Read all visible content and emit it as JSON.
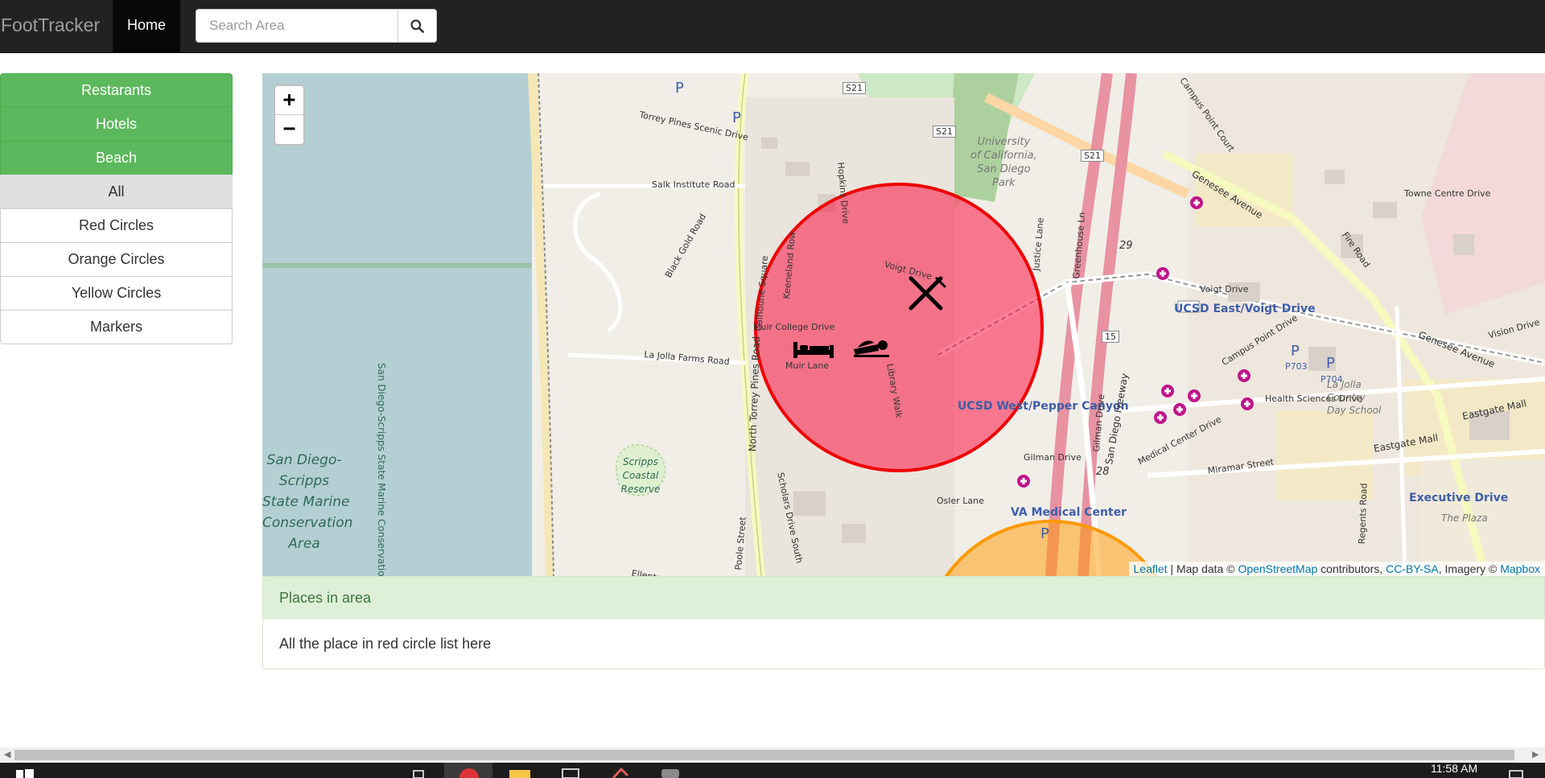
{
  "navbar": {
    "brand": "FootTracker",
    "home_label": "Home",
    "search": {
      "placeholder": "Search Area",
      "value": ""
    }
  },
  "sidebar": {
    "category_buttons": [
      {
        "label": "Restarants"
      },
      {
        "label": "Hotels"
      },
      {
        "label": "Beach"
      }
    ],
    "filter_items": [
      {
        "label": "All",
        "active": true
      },
      {
        "label": "Red Circles"
      },
      {
        "label": "Orange Circles"
      },
      {
        "label": "Yellow Circles"
      },
      {
        "label": "Markers"
      }
    ]
  },
  "map": {
    "zoom_in": "+",
    "zoom_out": "−",
    "attribution": {
      "leaflet": "Leaflet",
      "sep": " | Map data © ",
      "osm": "OpenStreetMap",
      "contributors": " contributors, ",
      "license": "CC-BY-SA",
      "imagery": ", Imagery © ",
      "mapbox": "Mapbox"
    },
    "labels": {
      "university": [
        "University",
        "of California,",
        "San Diego",
        "Park"
      ],
      "state_marine": [
        "San Diego-",
        "Scripps",
        "State Marine",
        "Conservation",
        "Area"
      ],
      "coastal_reserve": [
        "Scripps",
        "Coastal",
        "Reserve"
      ],
      "conservation_vertical": "San Diego-Scripps State Marine Conservation Area",
      "ucsd_east": "UCSD East/Voigt Drive",
      "ucsd_west": "UCSD West/Pepper Canyon",
      "va_medical": "VA Medical Center",
      "executive_drive": "Executive Drive",
      "la_jolla_country": [
        "La Jolla",
        "Country",
        "Day School"
      ],
      "the_plaza": "The Plaza",
      "p703": "P703",
      "p704": "P704",
      "parking": "P",
      "s21": "S21",
      "route_29": "29",
      "route_15": "15",
      "route_28": "28",
      "streets": {
        "torrey_pines_scenic": "Torrey Pines Scenic Drive",
        "salk_institute": "Salk Institute Road",
        "black_gold": "Black Gold Road",
        "la_jolla_farms": "La Jolla Farms Road",
        "north_torrey_pines": "North Torrey Pines Road",
        "muir_college": "Muir College Drive",
        "muir_lane": "Muir Lane",
        "voigt_drive": "Voigt Drive",
        "genesee": "Genesee Avenue",
        "campus_point": "Campus Point Drive",
        "campus_point_court": "Campus Point Court",
        "towne_centre": "Towne Centre Drive",
        "health_sciences": "Health Sciences Drive",
        "medical_center": "Medical Center Drive",
        "miramar": "Miramar Street",
        "eastgate_mall": "Eastgate Mall",
        "gilman": "Gilman Drive",
        "san_diego_freeway": "San Diego Freeway",
        "regents": "Regents Road",
        "osler": "Osler Lane",
        "scholars_south": "Scholars Drive South",
        "library_walk": "Library Walk",
        "justice_lane": "Justice Lane",
        "hopkins": "Hopkins Drive",
        "keeneland": "Keeneland Row",
        "calhoune": "Calhoune Square",
        "greenhouse": "Greenhouse Ln",
        "vision": "Vision Drive",
        "fire_road": "Fire Road",
        "ellentown": "Ellentown Road",
        "poole": "Poole Street"
      }
    },
    "circles": [
      {
        "color": "red",
        "fill": "#f03",
        "stroke": "#e00"
      },
      {
        "color": "orange",
        "fill": "#f90",
        "stroke": "#f90"
      }
    ],
    "markers": [
      {
        "icon": "fork-knife-icon",
        "category": "restaurant"
      },
      {
        "icon": "bed-icon",
        "category": "hotel"
      },
      {
        "icon": "beach-icon",
        "category": "beach"
      }
    ]
  },
  "panel": {
    "heading": "Places in area",
    "body": "All the place in red circle list here"
  },
  "taskbar": {
    "time": "11:58 AM"
  }
}
